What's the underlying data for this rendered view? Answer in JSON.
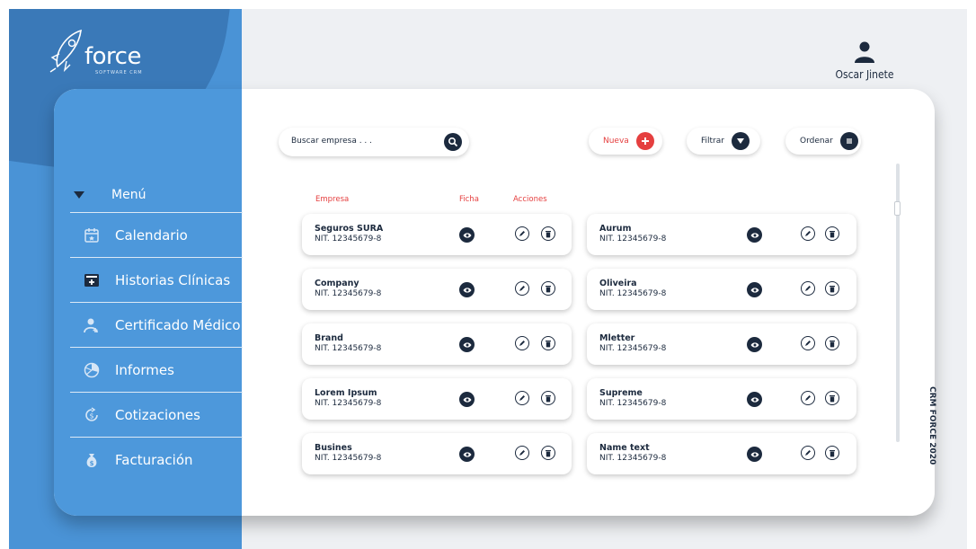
{
  "brand": {
    "name": "force",
    "tagline": "SOFTWARE CRM"
  },
  "user": {
    "name": "Oscar Jinete"
  },
  "menu": {
    "title": "Menú",
    "items": [
      {
        "label": "Calendario",
        "icon": "calendar-icon"
      },
      {
        "label": "Historias Clínicas",
        "icon": "medical-history-icon"
      },
      {
        "label": "Certificado Médico",
        "icon": "medical-certificate-icon"
      },
      {
        "label": "Informes",
        "icon": "reports-icon"
      },
      {
        "label": "Cotizaciones",
        "icon": "quotes-icon"
      },
      {
        "label": "Facturación",
        "icon": "money-bag-icon"
      }
    ]
  },
  "search": {
    "placeholder": "Buscar empresa . . ."
  },
  "toolbar": {
    "new_label": "Nueva",
    "filter_label": "Filtrar",
    "order_label": "Ordenar"
  },
  "table": {
    "headers": {
      "company": "Empresa",
      "file": "Ficha",
      "actions": "Acciones"
    },
    "left": [
      {
        "name": "Seguros SURA",
        "nit": "NIT. 12345679-8"
      },
      {
        "name": "Company",
        "nit": "NIT. 12345679-8"
      },
      {
        "name": "Brand",
        "nit": "NIT. 12345679-8"
      },
      {
        "name": "Lorem Ipsum",
        "nit": "NIT. 12345679-8"
      },
      {
        "name": "Busines",
        "nit": "NIT. 12345679-8"
      }
    ],
    "right": [
      {
        "name": "Aurum",
        "nit": "NIT. 12345679-8"
      },
      {
        "name": "Oliveira",
        "nit": "NIT. 12345679-8"
      },
      {
        "name": "Mletter",
        "nit": "NIT. 12345679-8"
      },
      {
        "name": "Supreme",
        "nit": "NIT. 12345679-8"
      },
      {
        "name": "Name text",
        "nit": "NIT. 12345679-8"
      }
    ]
  },
  "footer": {
    "vertical_label": "CRM FORCE 2020"
  },
  "colors": {
    "navy": "#1c2a3e",
    "accent_red": "#e53f3f",
    "sidebar_blue": "#4a93d6"
  }
}
